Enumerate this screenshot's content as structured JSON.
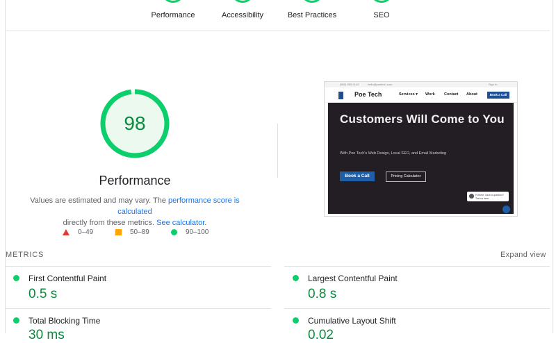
{
  "categories": [
    {
      "label": "Performance"
    },
    {
      "label": "Accessibility"
    },
    {
      "label": "Best Practices"
    },
    {
      "label": "SEO"
    }
  ],
  "gauge": {
    "score": "98",
    "score_fraction": 0.98,
    "title": "Performance",
    "color": "#0cce6b"
  },
  "description": {
    "part1": "Values are estimated and may vary. The ",
    "link1": "performance score is calculated",
    "part2": "directly from these metrics. ",
    "link2": "See calculator",
    "part3": "."
  },
  "legend": [
    {
      "range": "0–49",
      "icon": "red-triangle-icon",
      "color": "#e33b32"
    },
    {
      "range": "50–89",
      "icon": "orange-square-icon",
      "color": "#ffa400"
    },
    {
      "range": "90–100",
      "icon": "green-circle-icon",
      "color": "#0cce6b"
    }
  ],
  "thumbnail": {
    "phone": "(850) 555-0142",
    "email": "hello@poetech.com",
    "signin": "Sign In",
    "brand": "Poe Tech",
    "nav": [
      "Services ▾",
      "Work",
      "Contact",
      "About"
    ],
    "nav_button": "Book a Call",
    "headline": "Customers Will Come to You",
    "subline": "With Poe Tech's Web Design, Local SEO, and Email Marketing",
    "cta_primary": "Book a Call",
    "cta_secondary": "Pricing Calculator",
    "chat_line1": "Hi there, have a question?",
    "chat_line2": "Text us here."
  },
  "metrics": {
    "heading": "METRICS",
    "expand_label": "Expand view",
    "items": [
      {
        "name": "First Contentful Paint",
        "value": "0.5 s"
      },
      {
        "name": "Largest Contentful Paint",
        "value": "0.8 s"
      },
      {
        "name": "Total Blocking Time",
        "value": "30 ms"
      },
      {
        "name": "Cumulative Layout Shift",
        "value": "0.02"
      }
    ]
  }
}
